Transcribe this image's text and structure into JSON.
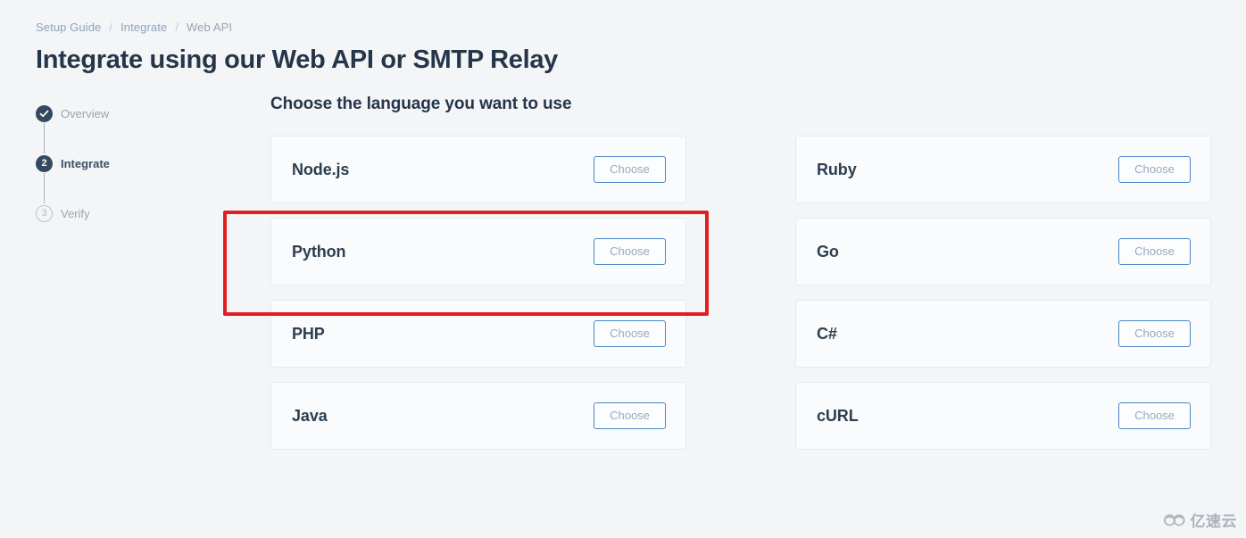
{
  "breadcrumb": {
    "items": [
      {
        "label": "Setup Guide",
        "type": "link"
      },
      {
        "label": "Integrate",
        "type": "link"
      },
      {
        "label": "Web API",
        "type": "current"
      }
    ],
    "separator": "/"
  },
  "header": {
    "title": "Integrate using our Web API or SMTP Relay"
  },
  "stepper": {
    "steps": [
      {
        "badge": "✓",
        "label": "Overview",
        "state": "done"
      },
      {
        "badge": "2",
        "label": "Integrate",
        "state": "active"
      },
      {
        "badge": "3",
        "label": "Verify",
        "state": "todo"
      }
    ]
  },
  "main": {
    "section_title": "Choose the language you want to use",
    "choose_label": "Choose",
    "columns": [
      {
        "cards": [
          {
            "name": "Node.js",
            "button": "Choose"
          },
          {
            "name": "Python",
            "button": "Choose"
          },
          {
            "name": "PHP",
            "button": "Choose"
          },
          {
            "name": "Java",
            "button": "Choose"
          }
        ]
      },
      {
        "cards": [
          {
            "name": "Ruby",
            "button": "Choose"
          },
          {
            "name": "Go",
            "button": "Choose"
          },
          {
            "name": "C#",
            "button": "Choose"
          },
          {
            "name": "cURL",
            "button": "Choose"
          }
        ]
      }
    ]
  },
  "annotation": {
    "color": "#e02020",
    "target": "Python"
  },
  "watermark": {
    "text": "亿速云"
  },
  "colors": {
    "page_background": "#f4f5f6",
    "card_background": "#fafbfc",
    "card_border": "#e6e9ec",
    "title": "#25364a",
    "link": "#8aa4c0",
    "muted": "#9aa5b1",
    "button_border": "#4a86c4",
    "button_text": "#98a9bd",
    "step_active": "#35495e",
    "annotation": "#e02020"
  }
}
